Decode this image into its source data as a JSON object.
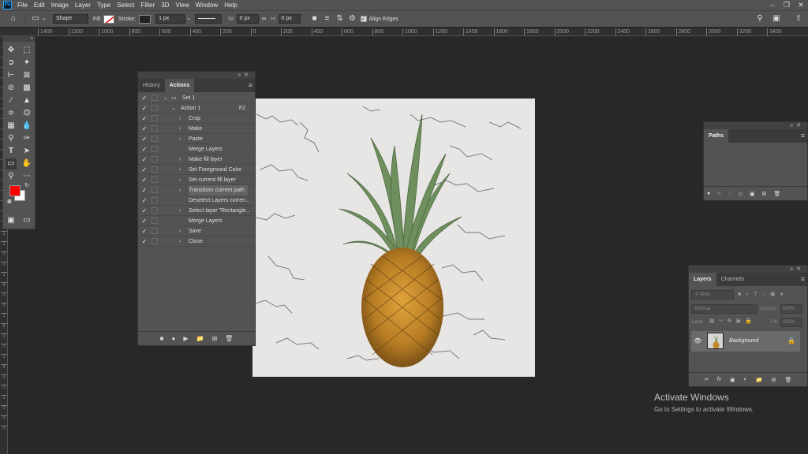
{
  "app": {
    "logo_text": "Ps"
  },
  "menu": [
    "File",
    "Edit",
    "Image",
    "Layer",
    "Type",
    "Select",
    "Filter",
    "3D",
    "View",
    "Window",
    "Help"
  ],
  "options_bar": {
    "mode": "Shape",
    "fill_label": "Fill:",
    "stroke_label": "Stroke:",
    "stroke_width": "1 px",
    "w_label": "W:",
    "w_value": "0 px",
    "h_label": "H:",
    "h_value": "0 px",
    "align_edges_label": "Align Edges"
  },
  "ruler": {
    "h_ticks": [
      "1400",
      "1200",
      "1000",
      "800",
      "600",
      "400",
      "200",
      "0",
      "200",
      "400",
      "600",
      "800",
      "1000",
      "1200",
      "1400",
      "1600",
      "1800",
      "2000",
      "2200",
      "2400",
      "2600",
      "2800",
      "3000",
      "3200",
      "3400"
    ],
    "v_ticks": [
      "2",
      "0",
      "0",
      "2",
      "0",
      "0",
      "4",
      "0",
      "0",
      "6",
      "0",
      "0",
      "8",
      "0",
      "0",
      "1",
      "0",
      "0",
      "0",
      "1",
      "2",
      "0",
      "0",
      "1",
      "4",
      "0",
      "0",
      "1",
      "6",
      "0",
      "0",
      "1",
      "8",
      "0",
      "0",
      "2",
      "0",
      "0",
      "0"
    ]
  },
  "colors": {
    "foreground": "#ff0000",
    "background": "#ffffff",
    "panel": "#535353",
    "canvas_bg": "#282828"
  },
  "history_actions_panel": {
    "tabs": [
      "History",
      "Actions"
    ],
    "active_tab": "Actions",
    "rows": [
      {
        "label": "Set 1",
        "level": 0,
        "type": "set",
        "checked": true
      },
      {
        "label": "Action 1",
        "level": 1,
        "type": "action",
        "fkey": "F2",
        "checked": true
      },
      {
        "label": "Crop",
        "level": 2,
        "type": "step",
        "expandable": true,
        "checked": true
      },
      {
        "label": "Make",
        "level": 2,
        "type": "step",
        "expandable": true,
        "checked": true
      },
      {
        "label": "Paste",
        "level": 2,
        "type": "step",
        "expandable": true,
        "checked": true
      },
      {
        "label": "Merge Layers",
        "level": 2,
        "type": "step",
        "expandable": false,
        "checked": true
      },
      {
        "label": "Make fill layer",
        "level": 2,
        "type": "step",
        "expandable": true,
        "checked": true
      },
      {
        "label": "Set Foreground Color",
        "level": 2,
        "type": "step",
        "expandable": true,
        "checked": true
      },
      {
        "label": "Set current fill layer",
        "level": 2,
        "type": "step",
        "expandable": true,
        "checked": true
      },
      {
        "label": "Transform current path",
        "level": 2,
        "type": "step",
        "expandable": true,
        "checked": true,
        "highlighted": true
      },
      {
        "label": "Deselect Layers curren...",
        "level": 2,
        "type": "step",
        "expandable": false,
        "checked": true
      },
      {
        "label": "Select layer \"Rectangle...",
        "level": 2,
        "type": "step",
        "expandable": true,
        "checked": true
      },
      {
        "label": "Merge Layers",
        "level": 2,
        "type": "step",
        "expandable": false,
        "checked": true
      },
      {
        "label": "Save",
        "level": 2,
        "type": "step",
        "expandable": true,
        "checked": true
      },
      {
        "label": "Close",
        "level": 2,
        "type": "step",
        "expandable": true,
        "checked": true
      }
    ]
  },
  "paths_panel": {
    "tab": "Paths"
  },
  "layers_panel": {
    "tabs": [
      "Layers",
      "Channels"
    ],
    "active_tab": "Layers",
    "kind_placeholder": "Kind",
    "blend_mode": "Normal",
    "opacity_label": "Opacity:",
    "opacity_value": "100%",
    "lock_label": "Lock:",
    "fill_label": "Fill:",
    "fill_value": "100%",
    "layer_name": "Background"
  },
  "watermark": {
    "title": "Activate Windows",
    "subtitle": "Go to Settings to activate Windows."
  }
}
